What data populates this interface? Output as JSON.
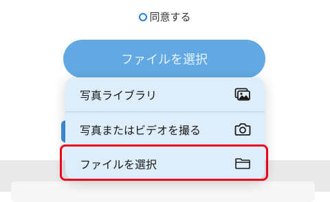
{
  "consent": {
    "label": "同意する",
    "checked": true
  },
  "upload": {
    "button_label": "ファイルを選択"
  },
  "menu": {
    "items": [
      {
        "label": "写真ライブラリ",
        "icon": "photo-library-icon"
      },
      {
        "label": "写真またはビデオを撮る",
        "icon": "camera-icon"
      },
      {
        "label": "ファイルを選択",
        "icon": "folder-icon"
      }
    ]
  },
  "colors": {
    "accent": "#1e7be8",
    "button": "#62a9e3",
    "menu_bg": "#ddedfa",
    "highlight": "#e8001c"
  }
}
